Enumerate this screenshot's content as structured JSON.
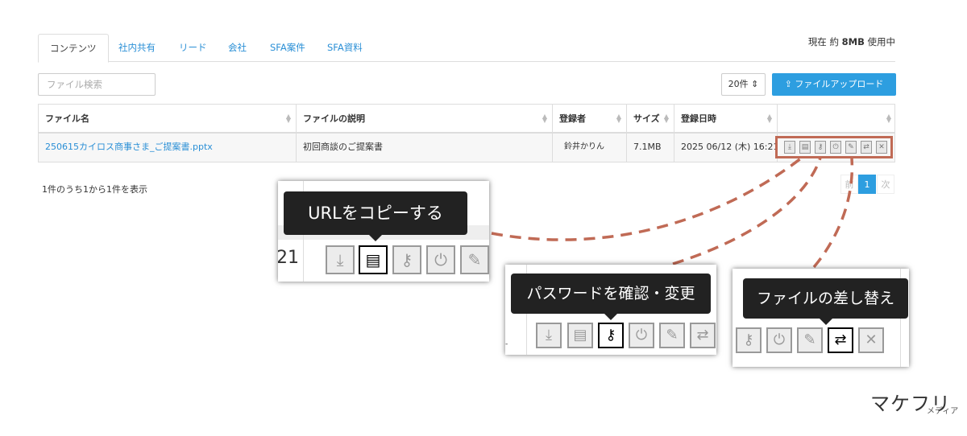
{
  "tabs": [
    "コンテンツ",
    "社内共有",
    "リード",
    "会社",
    "SFA案件",
    "SFA資料"
  ],
  "usage": {
    "prefix": "現在 約 ",
    "amount": "8MB",
    "suffix": " 使用中"
  },
  "search": {
    "placeholder": "ファイル検索"
  },
  "perpage": {
    "value": "20件 ⇕"
  },
  "upload_label": "ファイルアップロード",
  "table": {
    "headers": [
      "ファイル名",
      "ファイルの説明",
      "登録者",
      "サイズ",
      "登録日時"
    ],
    "row": {
      "name": "250615カイロス商事さま_ご提案書.pptx",
      "description": "初回商談のご提案書",
      "user": "鈴井かりん",
      "size": "7.1MB",
      "date": "2025 06/12 (木) 16:21"
    }
  },
  "info": "1件のうち1から1件を表示",
  "pager": {
    "prev": "前",
    "page": "1",
    "next": "次"
  },
  "callouts": {
    "copy_url": "URLをコピーする",
    "password": "パスワードを確認・変更",
    "replace": "ファイルの差し替え",
    "partial_time": "21"
  },
  "logo": {
    "main": "マケフリ",
    "sub": "メディア"
  },
  "colors": {
    "accent": "#2d9ee0",
    "highlight": "#c06a55"
  }
}
